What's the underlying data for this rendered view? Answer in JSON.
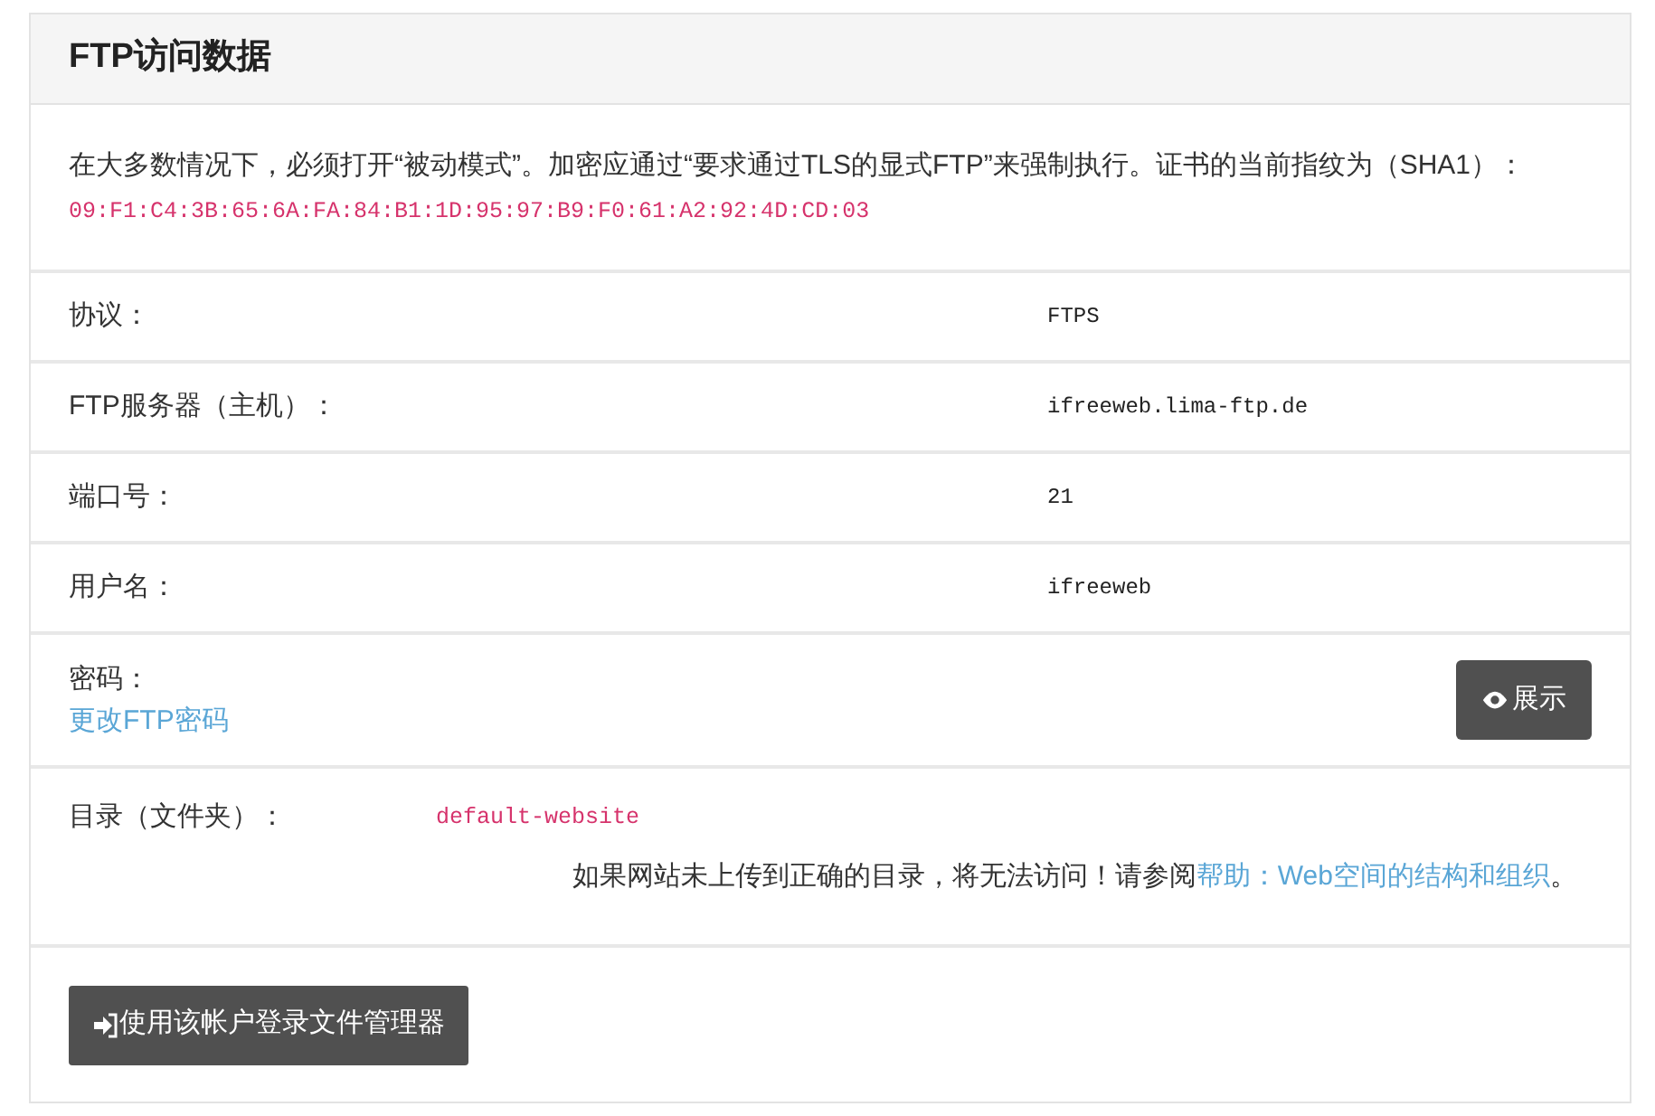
{
  "title": "FTP访问数据",
  "intro": {
    "text": "在大多数情况下，必须打开“被动模式”。加密应通过“要求通过TLS的显式FTP”来强制执行。证书的当前指纹为（SHA1）：",
    "fingerprint": "09:F1:C4:3B:65:6A:FA:84:B1:1D:95:97:B9:F0:61:A2:92:4D:CD:03"
  },
  "fields": [
    {
      "label": "协议：",
      "value": "FTPS"
    },
    {
      "label": "FTP服务器（主机）：",
      "value": "ifreeweb.lima-ftp.de"
    },
    {
      "label": "端口号：",
      "value": "21"
    },
    {
      "label": "用户名：",
      "value": "ifreeweb"
    }
  ],
  "password": {
    "label": "密码：",
    "link": "更改FTP密码",
    "button": "展示"
  },
  "directory": {
    "label": "目录（文件夹）：",
    "value": "default-website",
    "note": "如果网站未上传到正确的目录，将无法访问！请参阅",
    "note_link": "帮助：Web空间的结构和组织",
    "note_end": "。"
  },
  "file_manager_button": "使用该帐户登录文件管理器"
}
